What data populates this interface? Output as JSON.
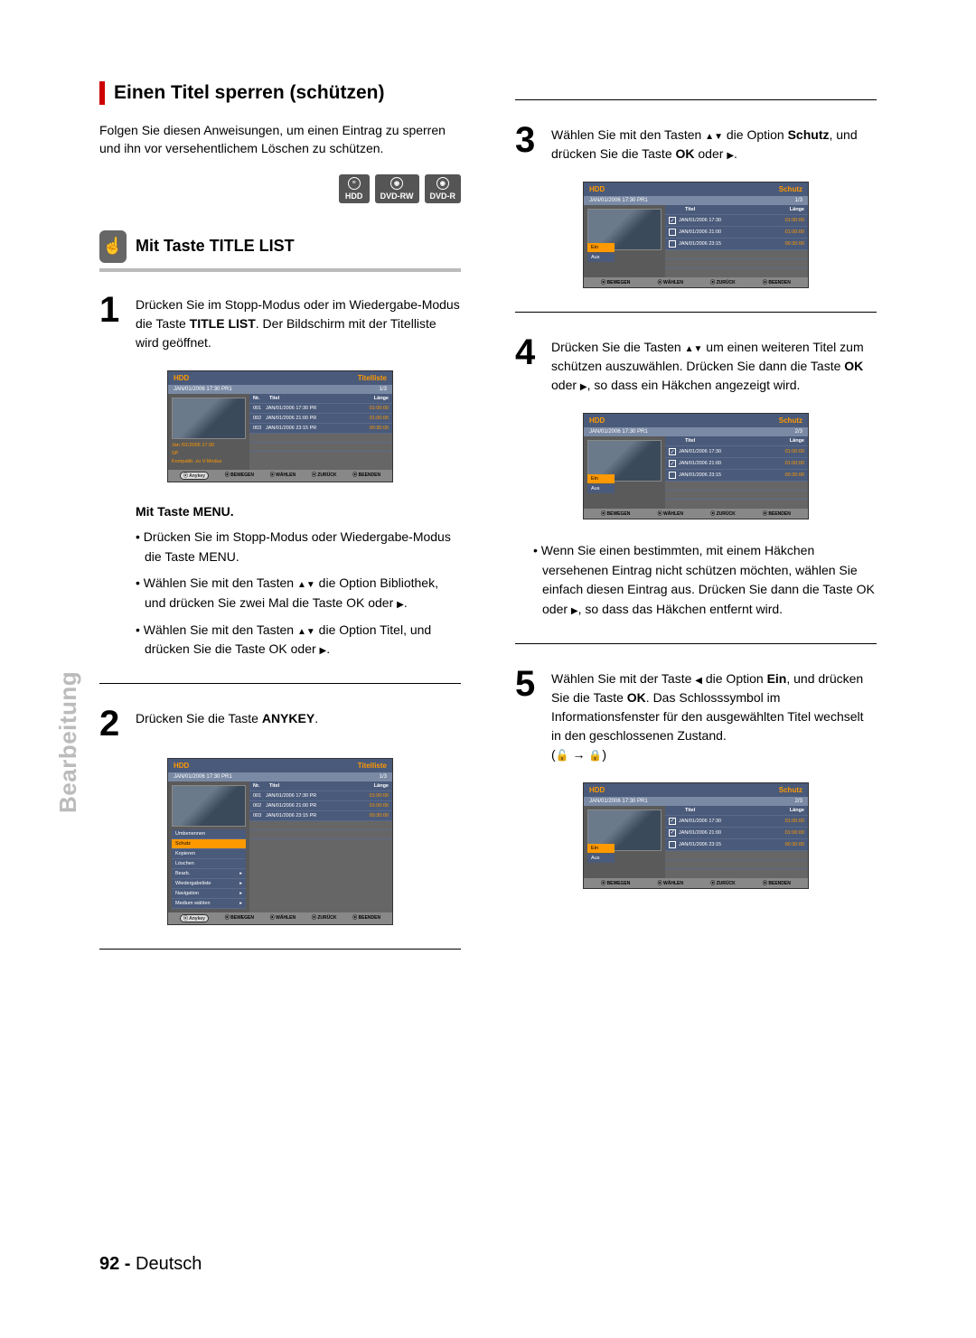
{
  "sideLabel": "Bearbeitung",
  "pageNumber": "92 -",
  "pageLang": "Deutsch",
  "sectionTitle": "Einen Titel sperren (schützen)",
  "intro": "Folgen Sie diesen Anweisungen, um einen Eintrag zu sperren und ihn vor versehentlichem Löschen zu schützen.",
  "badges": {
    "hdd": "HDD",
    "dvdrw": "DVD-RW",
    "dvdr": "DVD-R"
  },
  "subsectionTitle": "Mit Taste TITLE LIST",
  "step1": {
    "a": "Drücken Sie im Stopp-Modus oder im Wiedergabe-Modus die Taste ",
    "b": "TITLE LIST",
    "c": ". Der Bildschirm mit der Titelliste wird geöffnet."
  },
  "menuHeading": "Mit Taste MENU.",
  "menuBullets": {
    "b1a": "Drücken Sie im Stopp-Modus oder Wiedergabe-Modus die Taste ",
    "b1b": "MENU",
    "b1c": ".",
    "b2a": "Wählen Sie mit den Tasten ",
    "b2b": " die Option ",
    "b2c": "Bibliothek",
    "b2d": ", und drücken Sie zwei Mal die Taste ",
    "b2e": "OK",
    "b2f": " oder ",
    "b2g": ".",
    "b3a": "Wählen Sie mit den Tasten ",
    "b3b": " die Option ",
    "b3c": "Titel",
    "b3d": ", und drücken Sie die Taste ",
    "b3e": "OK",
    "b3f": " oder ",
    "b3g": "."
  },
  "step2": {
    "a": "Drücken Sie die Taste ",
    "b": "ANYKEY",
    "c": "."
  },
  "step3": {
    "a": "Wählen Sie mit den Tasten ",
    "b": " die Option ",
    "c": "Schutz",
    "d": ", und drücken Sie die Taste ",
    "e": "OK",
    "f": " oder ",
    "g": "."
  },
  "step4": {
    "a": "Drücken Sie die Tasten ",
    "b": " um einen weiteren Titel zum schützen auszuwählen. Drücken Sie dann die Taste ",
    "c": "OK",
    "d": " oder ",
    "e": ", so dass ein Häkchen angezeigt wird."
  },
  "step4Note": {
    "a": "Wenn Sie einen bestimmten, mit einem Häkchen versehenen Eintrag nicht schützen möchten, wählen Sie einfach diesen Eintrag aus. Drücken Sie dann die Taste ",
    "b": "OK",
    "c": " oder ",
    "d": ", so dass das Häkchen entfernt wird."
  },
  "step5": {
    "a": "Wählen Sie mit der Taste ",
    "b": " die Option ",
    "c": "Ein",
    "d": ", und drücken Sie die Taste ",
    "e": "OK",
    "f": ". Das Schlosssymbol im Informationsfenster für den ausgewählten Titel wechselt in den geschlossenen Zustand."
  },
  "ss": {
    "hdd": "HDD",
    "titelliste": "Titelliste",
    "schutz": "Schutz",
    "date": "JAN/01/2006 17:30 PR1",
    "frac13": "1/3",
    "frac23": "2/3",
    "cols": {
      "nr": "Nr.",
      "titel": "Titel",
      "laenge": "Länge"
    },
    "rows": [
      {
        "nr": "001",
        "t": "JAN/01/2006 17:30 PR",
        "l": "01:00:00"
      },
      {
        "nr": "002",
        "t": "JAN/01/2006 21:00 PR",
        "l": "01:00:00"
      },
      {
        "nr": "003",
        "t": "JAN/01/2006 23:15 PR",
        "l": "00:30:00"
      }
    ],
    "rowsB": [
      {
        "t": "JAN/01/2006 17:30",
        "l": "01:00:00"
      },
      {
        "t": "JAN/01/2006 21:00",
        "l": "01:00:00"
      },
      {
        "t": "JAN/01/2006 23:15",
        "l": "00:30:00"
      }
    ],
    "info": {
      "l1": "Jan /01/2006 17:30",
      "l2": "SP",
      "l3": "Kompatib. zu V-Modus"
    },
    "menu": {
      "umbenennen": "Umbenennen",
      "schutz": "Schutz",
      "kopieren": "Kopieren",
      "loeschen": "Löschen",
      "bearb": "Bearb.",
      "wiedergabeliste": "Wiedergabeliste",
      "navigation": "Navigation",
      "medium": "Medium wählen"
    },
    "einaus": {
      "ein": "Ein",
      "aus": "Aus"
    },
    "footer": {
      "bewegen": "BEWEGEN",
      "waehlen": "WÄHLEN",
      "zurueck": "ZURÜCK",
      "beenden": "BEENDEN"
    },
    "anykey": "Anykey"
  }
}
